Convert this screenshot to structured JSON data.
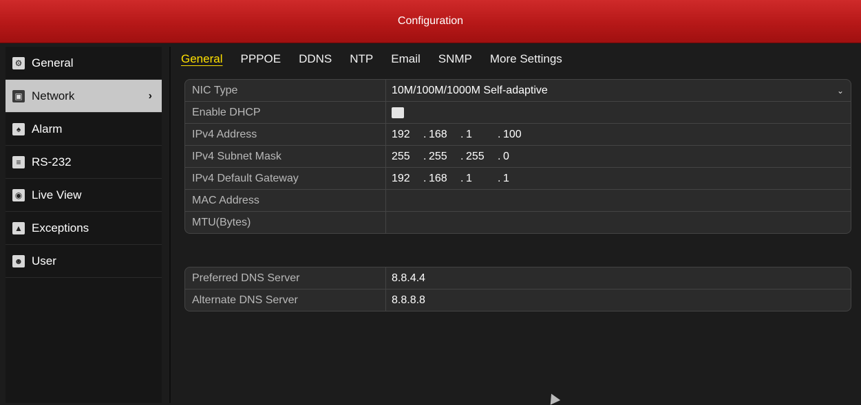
{
  "title": "Configuration",
  "sidebar": {
    "items": [
      {
        "label": "General",
        "icon": "gear-icon",
        "glyph": "⚙"
      },
      {
        "label": "Network",
        "icon": "network-icon",
        "glyph": "🖧",
        "active": true
      },
      {
        "label": "Alarm",
        "icon": "alarm-icon",
        "glyph": "🔔"
      },
      {
        "label": "RS-232",
        "icon": "rs232-icon",
        "glyph": "≡"
      },
      {
        "label": "Live View",
        "icon": "eye-icon",
        "glyph": "👁"
      },
      {
        "label": "Exceptions",
        "icon": "warning-icon",
        "glyph": "⚠"
      },
      {
        "label": "User",
        "icon": "user-icon",
        "glyph": "👥"
      }
    ],
    "active_arrow": "›"
  },
  "tabs": [
    "General",
    "PPPOE",
    "DDNS",
    "NTP",
    "Email",
    "SNMP",
    "More Settings"
  ],
  "network": {
    "nic_type_label": "NIC Type",
    "nic_type_value": "10M/100M/1000M Self-adaptive",
    "dhcp_label": "Enable DHCP",
    "ipv4_label": "IPv4 Address",
    "ipv4": [
      "192",
      "168",
      "1",
      "100"
    ],
    "subnet_label": "IPv4 Subnet Mask",
    "subnet": [
      "255",
      "255",
      "255",
      "0"
    ],
    "gateway_label": "IPv4 Default Gateway",
    "gateway": [
      "192",
      "168",
      "1",
      "1"
    ],
    "mac_label": "MAC Address",
    "mac_value": "",
    "mtu_label": "MTU(Bytes)",
    "mtu_value": ""
  },
  "dns": {
    "preferred_label": "Preferred DNS Server",
    "preferred_value": "8.8.4.4",
    "alternate_label": "Alternate DNS Server",
    "alternate_value": "8.8.8.8"
  },
  "colors": {
    "title_bar": "#c21e1e",
    "active_tab": "#ffe000",
    "active_sidebar": "#c8c8c8"
  }
}
